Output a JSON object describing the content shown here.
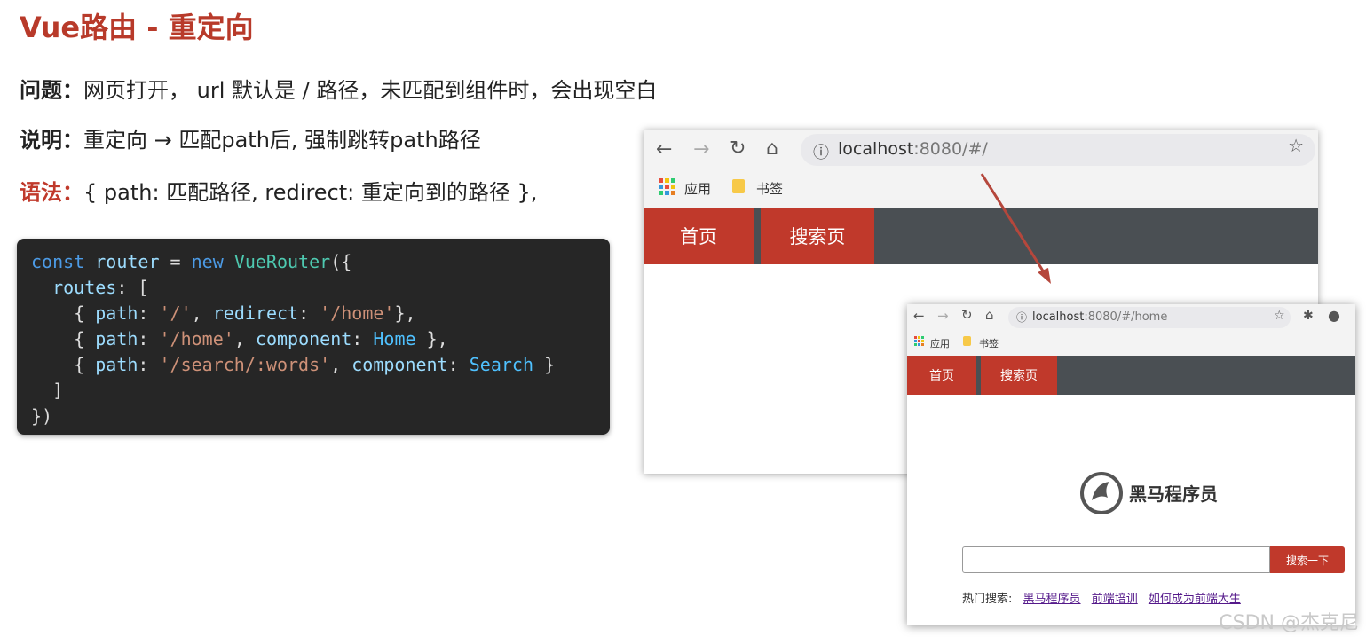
{
  "slide": {
    "title": "Vue路由 - 重定向",
    "problem_label": "问题：",
    "problem_text": "网页打开， url 默认是 / 路径，未匹配到组件时，会出现空白",
    "explain_label": "说明：",
    "explain_text": "重定向 → 匹配path后, 强制跳转path路径",
    "syntax_label": "语法：",
    "syntax_text": "{ path: 匹配路径, redirect: 重定向到的路径 },"
  },
  "code": {
    "kw_const": "const",
    "var_router": "router",
    "eq": " = ",
    "kw_new": "new",
    "cls": "VueRouter",
    "open": "({",
    "prop_routes": "routes",
    "arr_open": ": [",
    "prop_path": "path",
    "prop_redirect": "redirect",
    "prop_component": "component",
    "s_root": "'/'",
    "s_home": "'/home'",
    "s_search": "'/search/:words'",
    "id_home": "Home",
    "id_search": "Search",
    "arr_close": "]",
    "close": "})"
  },
  "browser_main": {
    "info_icon": "ⓘ",
    "url_host": "localhost",
    "url_rest": ":8080/#/",
    "bookmark_apps": "应用",
    "bookmark_folder": "书签",
    "nav_home": "首页",
    "nav_search": "搜索页"
  },
  "browser_home": {
    "info_icon": "ⓘ",
    "url_host": "localhost",
    "url_rest": ":8080/#/home",
    "bookmark_apps": "应用",
    "bookmark_folder": "书签",
    "nav_home": "首页",
    "nav_search": "搜索页",
    "logo_text": "黑马程序员",
    "search_placeholder": "",
    "search_button": "搜索一下",
    "hot_label": "热门搜索:",
    "hot_links": [
      "黑马程序员",
      "前端培训",
      "如何成为前端大生"
    ]
  },
  "watermark": "CSDN @杰克尼",
  "colors": {
    "accent_red": "#c0392b",
    "navbar_gray": "#4a4f53",
    "code_bg": "#262626"
  }
}
